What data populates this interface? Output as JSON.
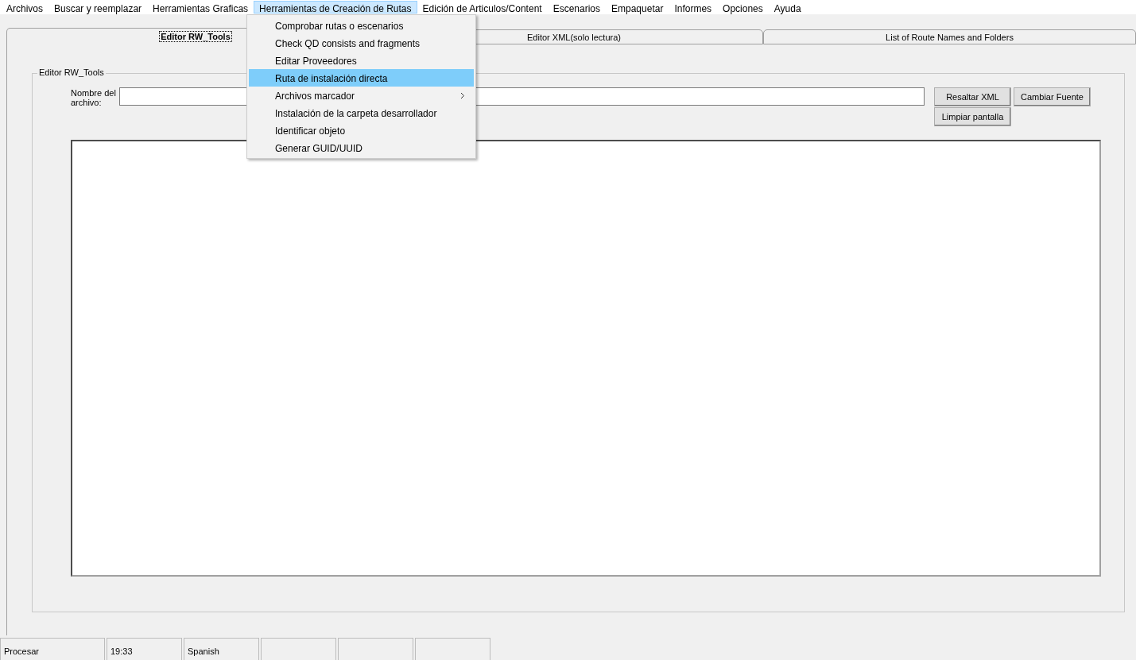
{
  "menu_bar": [
    {
      "label": "Archivos",
      "selected": false
    },
    {
      "label": "Buscar y reemplazar",
      "selected": false
    },
    {
      "label": "Herramientas Graficas",
      "selected": false
    },
    {
      "label": "Herramientas de Creación de Rutas",
      "selected": true
    },
    {
      "label": "Edición de Articulos/Content",
      "selected": false
    },
    {
      "label": "Escenarios",
      "selected": false
    },
    {
      "label": "Empaquetar",
      "selected": false
    },
    {
      "label": "Informes",
      "selected": false
    },
    {
      "label": "Opciones",
      "selected": false
    },
    {
      "label": "Ayuda",
      "selected": false
    }
  ],
  "dropdown_menu": [
    {
      "label": "Comprobar rutas o escenarios",
      "selected": false,
      "has_submenu": false
    },
    {
      "label": "Check QD consists and fragments",
      "selected": false,
      "has_submenu": false
    },
    {
      "label": "Editar Proveedores",
      "selected": false,
      "has_submenu": false
    },
    {
      "label": "Ruta de instalación directa",
      "selected": true,
      "has_submenu": false
    },
    {
      "label": "Archivos marcador",
      "selected": false,
      "has_submenu": true
    },
    {
      "label": "Instalación de la carpeta desarrollador",
      "selected": false,
      "has_submenu": false
    },
    {
      "label": "Identificar objeto",
      "selected": false,
      "has_submenu": false
    },
    {
      "label": "Generar GUID/UUID",
      "selected": false,
      "has_submenu": false
    }
  ],
  "tabs": [
    {
      "label": "Editor RW_Tools",
      "selected": true
    },
    {
      "label": "Editor XML(solo lectura)",
      "selected": false
    },
    {
      "label": "List of Route Names and Folders",
      "selected": false
    }
  ],
  "group": {
    "title": "Editor RW_Tools",
    "file_label": "Nombre del archivo:",
    "buttons": [
      {
        "label": "Resaltar XML"
      },
      {
        "label": "Limpiar pantalla"
      },
      {
        "label": "Cambiar Fuente"
      }
    ]
  },
  "status_bar": [
    {
      "text": "Procesar"
    },
    {
      "text": "19:33"
    },
    {
      "text": "Spanish"
    }
  ]
}
